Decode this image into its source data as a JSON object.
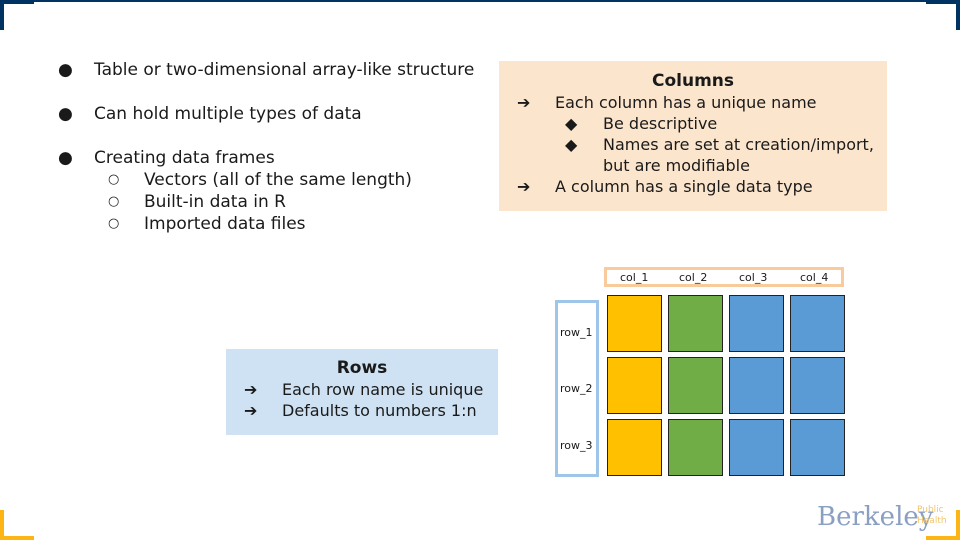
{
  "bullets": [
    {
      "text": "Table or two-dimensional array-like structure",
      "level": 1
    },
    {
      "text": "Can hold multiple types of data",
      "level": 1
    },
    {
      "text": "Creating data frames",
      "level": 1
    },
    {
      "text": "Vectors (all of the same length)",
      "level": 2
    },
    {
      "text": "Built-in data in R",
      "level": 2
    },
    {
      "text": "Imported data files",
      "level": 2
    }
  ],
  "columns_box": {
    "title": "Columns",
    "items": [
      "Each column has a unique name",
      "Be descriptive",
      "Names are set at creation/import,",
      "but are modifiable",
      "A column has a single data type"
    ]
  },
  "rows_box": {
    "title": "Rows",
    "items": [
      "Each row name is unique",
      "Defaults to numbers 1:n"
    ]
  },
  "frame": {
    "col_names": [
      "col_1",
      "col_2",
      "col_3",
      "col_4"
    ],
    "row_names": [
      "row_1",
      "row_2",
      "row_3"
    ],
    "column_colors": [
      "#ffc000",
      "#70ad47",
      "#5b9bd5",
      "#5b9bd5"
    ]
  },
  "logo": {
    "word": "Berkeley",
    "sub1": "Public",
    "sub2": "Health"
  },
  "colors": {
    "navy": "#003262",
    "gold": "#fdb515",
    "peach": "#fce5cd",
    "light_blue": "#cfe2f3"
  }
}
